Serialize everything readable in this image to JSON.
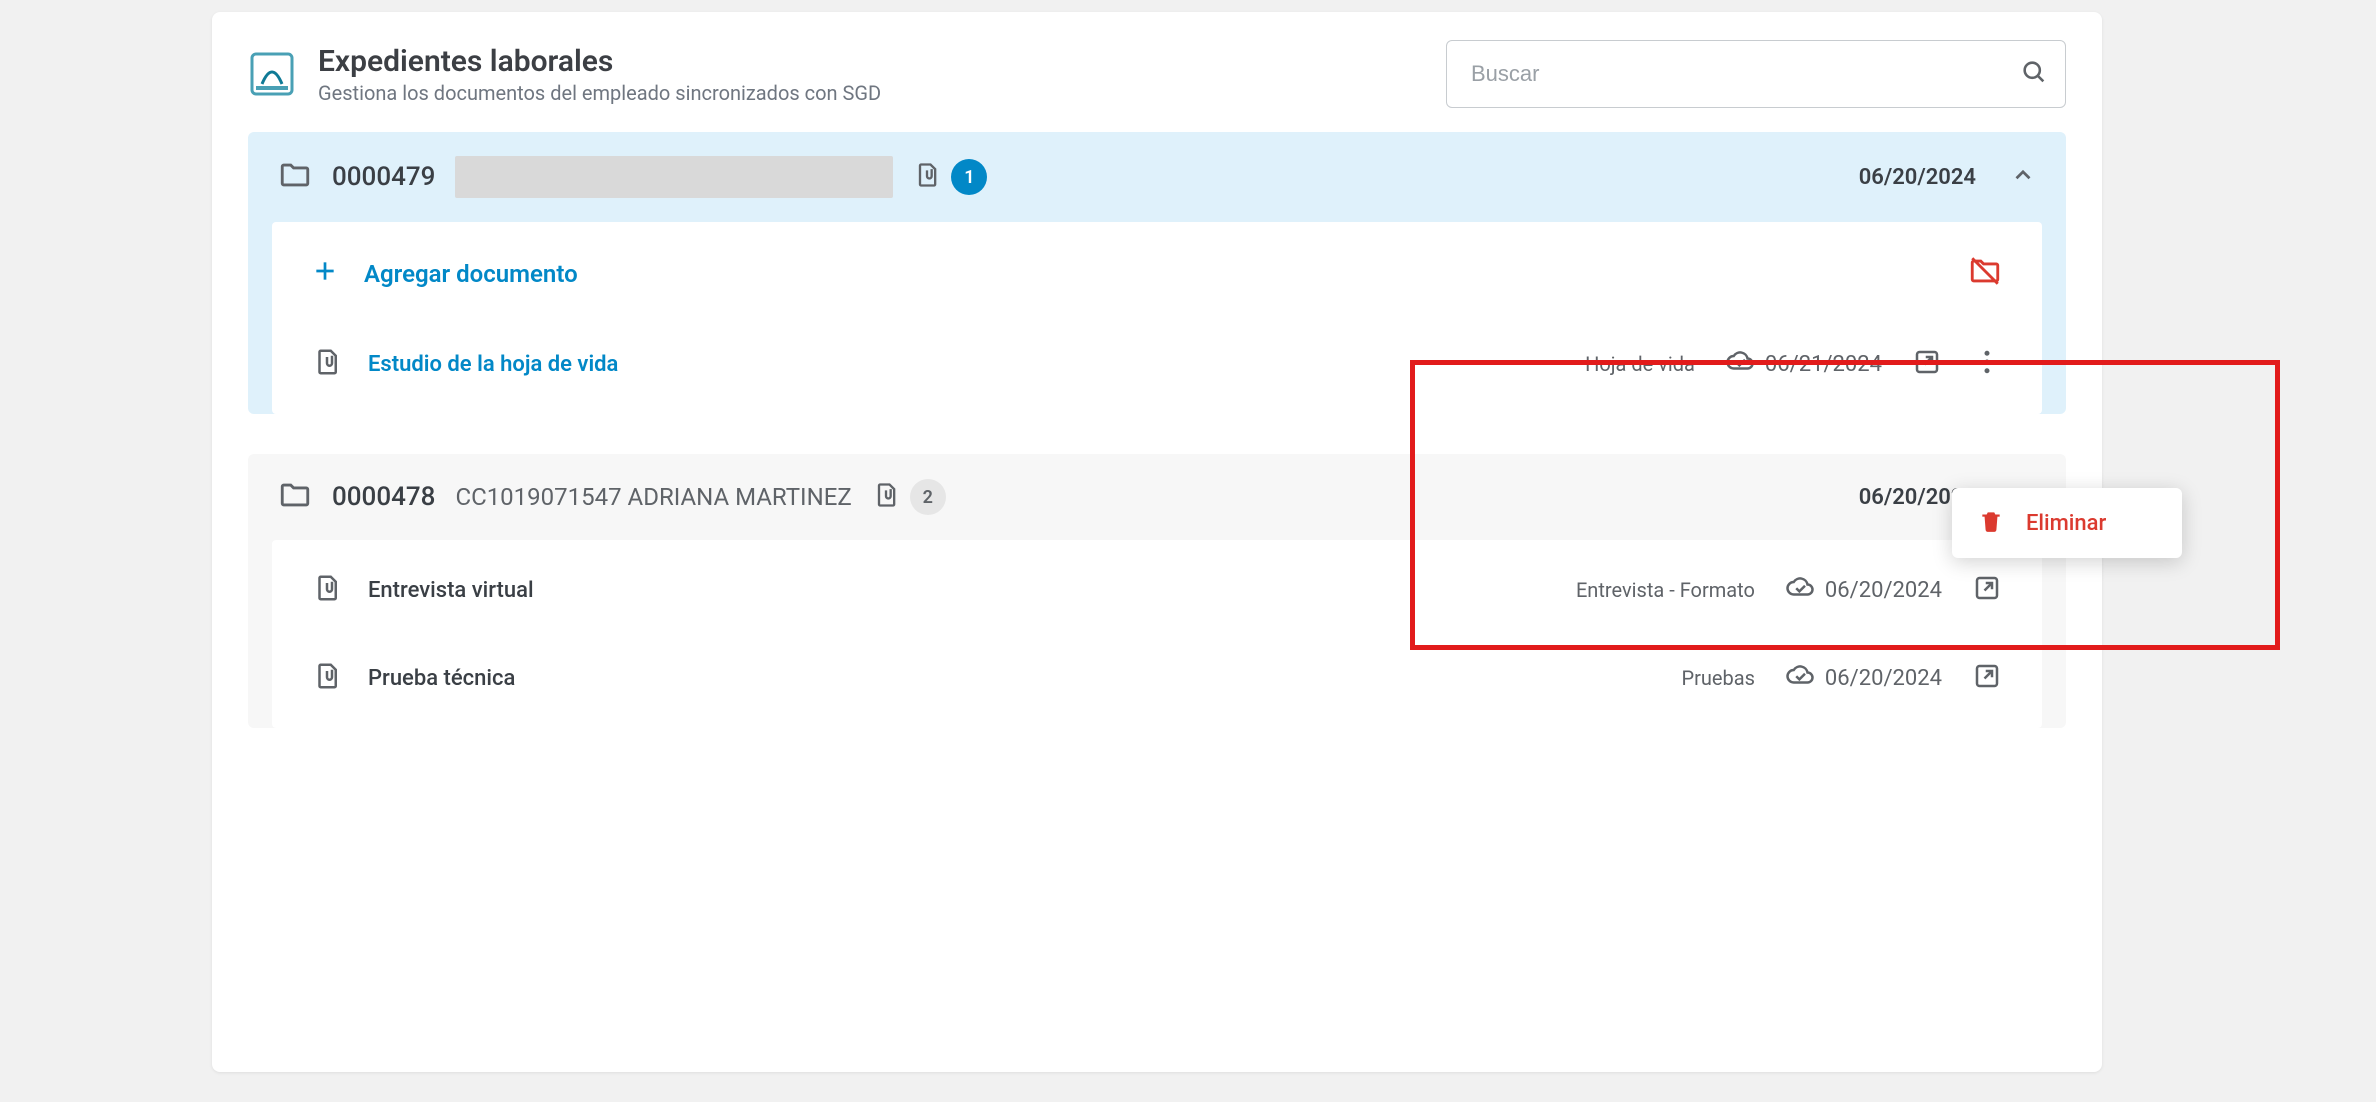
{
  "header": {
    "title": "Expedientes laborales",
    "subtitle": "Gestiona los documentos del empleado sincronizados con SGD"
  },
  "search": {
    "placeholder": "Buscar"
  },
  "folders": [
    {
      "id": "0000479",
      "name_redacted": true,
      "badge_count": "1",
      "badge_style": "blue",
      "date": "06/20/2024",
      "active": true,
      "add_label": "Agregar documento",
      "documents": [
        {
          "title": "Estudio de la hoja de vida",
          "category": "Hoja de vida",
          "date": "06/21/2024",
          "highlight": true,
          "show_menu": true
        }
      ]
    },
    {
      "id": "0000478",
      "name": "CC1019071547 ADRIANA MARTINEZ",
      "name_redacted": false,
      "badge_count": "2",
      "badge_style": "grey",
      "date": "06/20/2024",
      "active": false,
      "documents": [
        {
          "title": "Entrevista virtual",
          "category": "Entrevista - Formato",
          "date": "06/20/2024",
          "highlight": false
        },
        {
          "title": "Prueba técnica",
          "category": "Pruebas",
          "date": "06/20/2024",
          "highlight": false
        }
      ]
    }
  ],
  "menu": {
    "delete_label": "Eliminar"
  }
}
